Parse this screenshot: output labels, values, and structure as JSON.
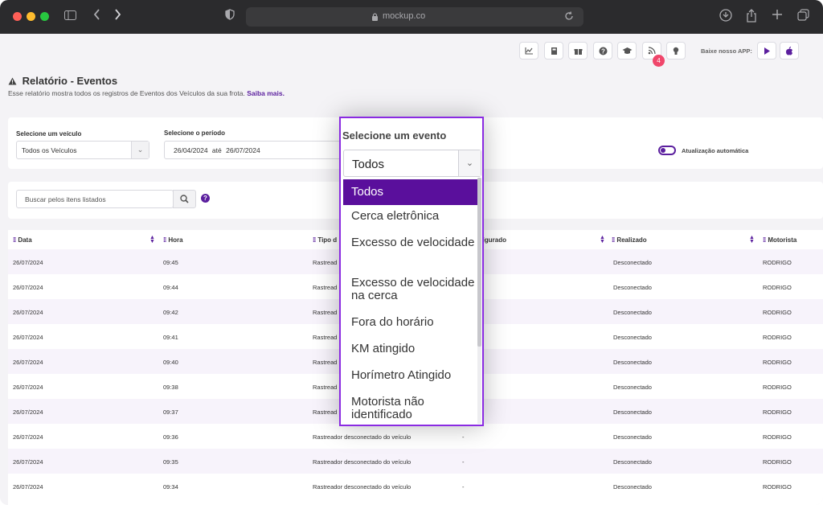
{
  "browser": {
    "url": "mockup.co"
  },
  "header": {
    "notification_count": "4",
    "app_label": "Baixe nosso APP:"
  },
  "page": {
    "title": "Relatório - Eventos",
    "description": "Esse relatório mostra todos os registros de Eventos dos Veículos da sua frota.",
    "learn_more": "Saiba mais."
  },
  "filters": {
    "vehicle_label": "Selecione um veículo",
    "vehicle_value": "Todos os Veículos",
    "period_label": "Selecione o período",
    "period_start": "26/04/2024",
    "period_sep": "até",
    "period_end": "26/07/2024",
    "auto_update_label": "Atualização automática"
  },
  "search": {
    "placeholder": "Buscar pelos itens listados"
  },
  "table": {
    "columns": {
      "data": "Data",
      "hora": "Hora",
      "tipo": "Tipo d",
      "configurado": "figurado",
      "realizado": "Realizado",
      "motorista": "Motorista"
    },
    "rows": [
      {
        "data": "26/07/2024",
        "hora": "09:45",
        "tipo": "Rastread",
        "configurado": "",
        "realizado": "Desconectado",
        "motorista": "RODRIGO"
      },
      {
        "data": "26/07/2024",
        "hora": "09:44",
        "tipo": "Rastread",
        "configurado": "",
        "realizado": "Desconectado",
        "motorista": "RODRIGO"
      },
      {
        "data": "26/07/2024",
        "hora": "09:42",
        "tipo": "Rastread",
        "configurado": "",
        "realizado": "Desconectado",
        "motorista": "RODRIGO"
      },
      {
        "data": "26/07/2024",
        "hora": "09:41",
        "tipo": "Rastread",
        "configurado": "",
        "realizado": "Desconectado",
        "motorista": "RODRIGO"
      },
      {
        "data": "26/07/2024",
        "hora": "09:40",
        "tipo": "Rastread",
        "configurado": "",
        "realizado": "Desconectado",
        "motorista": "RODRIGO"
      },
      {
        "data": "26/07/2024",
        "hora": "09:38",
        "tipo": "Rastread",
        "configurado": "",
        "realizado": "Desconectado",
        "motorista": "RODRIGO"
      },
      {
        "data": "26/07/2024",
        "hora": "09:37",
        "tipo": "Rastread",
        "configurado": "",
        "realizado": "Desconectado",
        "motorista": "RODRIGO"
      },
      {
        "data": "26/07/2024",
        "hora": "09:36",
        "tipo": "Rastreador desconectado do veículo",
        "configurado": "-",
        "realizado": "Desconectado",
        "motorista": "RODRIGO"
      },
      {
        "data": "26/07/2024",
        "hora": "09:35",
        "tipo": "Rastreador desconectado do veículo",
        "configurado": "-",
        "realizado": "Desconectado",
        "motorista": "RODRIGO"
      },
      {
        "data": "26/07/2024",
        "hora": "09:34",
        "tipo": "Rastreador desconectado do veículo",
        "configurado": "-",
        "realizado": "Desconectado",
        "motorista": "RODRIGO"
      }
    ]
  },
  "event_dropdown": {
    "label": "Selecione um evento",
    "selected": "Todos",
    "options": [
      "Todos",
      "Cerca eletrônica",
      "Excesso de velocidade",
      "Excesso de velocidade na cerca",
      "Fora do horário",
      "KM atingido",
      "Horímetro Atingido",
      "Motorista não identificado"
    ]
  },
  "colors": {
    "accent": "#5a0f9c",
    "highlight_border": "#8a2be2",
    "row_alt": "#f7f3fb",
    "badge": "#f0466b"
  }
}
